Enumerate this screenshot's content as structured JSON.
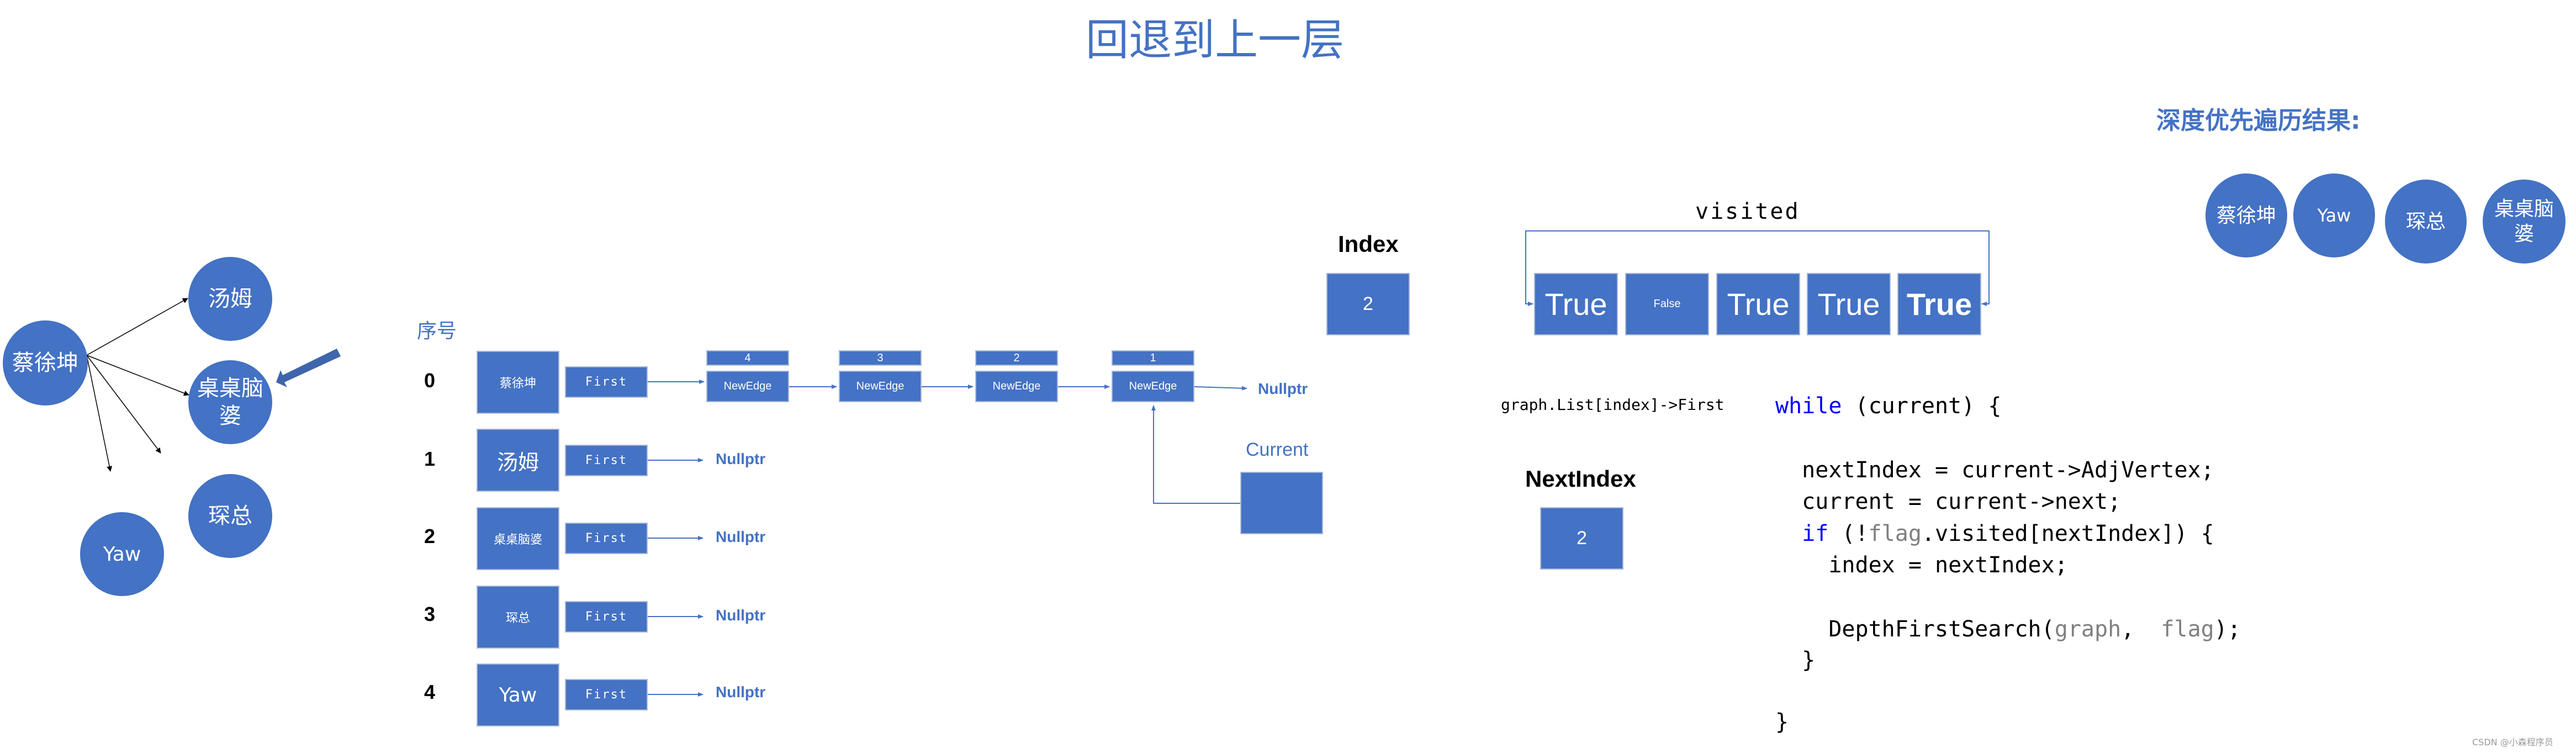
{
  "title": "回退到上一层",
  "graph": {
    "nodes": [
      {
        "id": 0,
        "label": "蔡徐坤"
      },
      {
        "id": 1,
        "label": "汤姆"
      },
      {
        "id": 2,
        "label": "桌桌脑婆"
      },
      {
        "id": 3,
        "label": "琛总"
      },
      {
        "id": 4,
        "label": "Yaw"
      }
    ],
    "edges": [
      {
        "from": 0,
        "to": 1
      },
      {
        "from": 0,
        "to": 2
      },
      {
        "from": 0,
        "to": 3
      },
      {
        "from": 0,
        "to": 4
      }
    ],
    "highlighted_node": 2
  },
  "adjacency": {
    "header": "序号",
    "rows": [
      {
        "index": "0",
        "vertex": "蔡徐坤",
        "first": "First"
      },
      {
        "index": "1",
        "vertex": "汤姆",
        "first": "First",
        "tail": "Nullptr"
      },
      {
        "index": "2",
        "vertex": "桌桌脑婆",
        "first": "First",
        "tail": "Nullptr"
      },
      {
        "index": "3",
        "vertex": "琛总",
        "first": "First",
        "tail": "Nullptr"
      },
      {
        "index": "4",
        "vertex": "Yaw",
        "first": "First",
        "tail": "Nullptr"
      }
    ],
    "edge_chain": [
      {
        "adj": "4",
        "label": "NewEdge"
      },
      {
        "adj": "3",
        "label": "NewEdge"
      },
      {
        "adj": "2",
        "label": "NewEdge"
      },
      {
        "adj": "1",
        "label": "NewEdge"
      }
    ],
    "chain_tail": "Nullptr",
    "current_label": "Current"
  },
  "index": {
    "label": "Index",
    "value": "2"
  },
  "visited": {
    "label": "visited",
    "values": [
      "True",
      "False",
      "True",
      "True",
      "True"
    ]
  },
  "list_expr": "graph.List[index]->First",
  "next_index": {
    "label": "NextIndex",
    "value": "2"
  },
  "code": {
    "line1_kw": "while",
    "line1_rest": " (current) {",
    "line2": "  nextIndex = current->AdjVertex;",
    "line3": "  current = current->next;",
    "line4_kw": "if",
    "line4_a": " (!",
    "line4_flag": "flag",
    "line4_b": ".visited[nextIndex]) {",
    "line5": "    index = nextIndex;",
    "line6_fn": "    DepthFirstSearch(",
    "line6_p1": "graph",
    "line6_sep": ",  ",
    "line6_p2": "flag",
    "line6_end": ");",
    "line7": "  }",
    "line8": "}"
  },
  "dfs_result": {
    "title": "深度优先遍历结果:",
    "order": [
      "蔡徐坤",
      "Yaw",
      "琛总",
      "桌桌脑婆"
    ]
  },
  "watermark": "CSDN @小森程序员",
  "colors": {
    "accent": "#4472C4",
    "keyword": "#0000FF",
    "param": "#808080"
  }
}
